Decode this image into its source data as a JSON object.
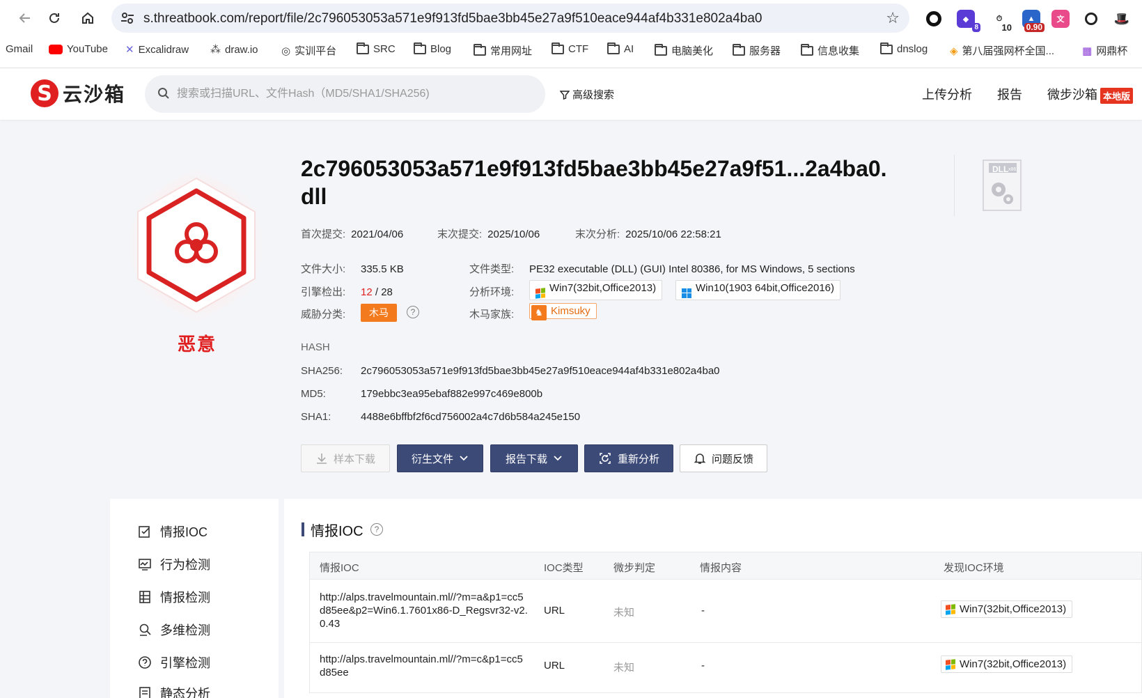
{
  "browser": {
    "url": "s.threatbook.com/report/file/2c796053053a571e9f913fd5bae3bb45e27a9f510eace944af4b331e802a4ba0",
    "extensions": [
      {
        "name": "circle-extension-icon",
        "badge": ""
      },
      {
        "name": "shield-extension-icon",
        "badge": "8"
      },
      {
        "name": "timer-extension-icon",
        "badge": "10"
      },
      {
        "name": "score-extension-icon",
        "badge": "0.90"
      },
      {
        "name": "translate-extension-icon",
        "badge": ""
      },
      {
        "name": "chatgpt-extension-icon",
        "badge": ""
      },
      {
        "name": "hat-extension-icon",
        "badge": ""
      }
    ],
    "bookmarks": [
      "Gmail",
      "YouTube",
      "Excalidraw",
      "draw.io",
      "实训平台",
      "SRC",
      "Blog",
      "常用网址",
      "CTF",
      "AI",
      "电脑美化",
      "服务器",
      "信息收集",
      "dnslog",
      "第八届强网杯全国...",
      "网鼎杯"
    ]
  },
  "header": {
    "logo_text": "云沙箱",
    "logo_letter": "S",
    "search_placeholder": "搜索或扫描URL、文件Hash（MD5/SHA1/SHA256)",
    "advanced_search": "高级搜索",
    "nav": [
      "上传分析",
      "报告",
      "微步沙箱"
    ],
    "local_badge": "本地版"
  },
  "summary": {
    "verdict": "恶意",
    "title": "2c796053053a571e9f913fd5bae3bb45e27a9f51...2a4ba0.dll",
    "file_type_badge": "DLL",
    "file_arch_badge": "x86",
    "first_submit_label": "首次提交:",
    "first_submit": "2021/04/06",
    "last_submit_label": "末次提交:",
    "last_submit": "2025/10/06",
    "last_analysis_label": "末次分析:",
    "last_analysis": "2025/10/06 22:58:21",
    "file_size_label": "文件大小:",
    "file_size": "335.5 KB",
    "file_type_label": "文件类型:",
    "file_type": "PE32 executable (DLL) (GUI) Intel 80386, for MS Windows, 5 sections",
    "engine_label": "引擎检出:",
    "engine_detected": "12",
    "engine_total": " / 28",
    "env_label": "分析环境:",
    "envs": [
      "Win7(32bit,Office2013)",
      "Win10(1903 64bit,Office2016)"
    ],
    "threat_label": "威胁分类:",
    "threat_class": "木马",
    "family_label": "木马家族:",
    "family": "Kimsuky",
    "help_glyph": "?"
  },
  "hash": {
    "label": "HASH",
    "sha256_label": "SHA256:",
    "sha256": "2c796053053a571e9f913fd5bae3bb45e27a9f510eace944af4b331e802a4ba0",
    "md5_label": "MD5:",
    "md5": "179ebbc3ea95ebaf882e997c469e800b",
    "sha1_label": "SHA1:",
    "sha1": "4488e6bffbf2f6cd756002a4c7d6b584a245e150"
  },
  "actions": {
    "download_sample": "样本下载",
    "derived_files": "衍生文件",
    "report_download": "报告下载",
    "reanalyze": "重新分析",
    "feedback": "问题反馈"
  },
  "sidebar": {
    "items": [
      "情报IOC",
      "行为检测",
      "情报检测",
      "多维检测",
      "引擎检测",
      "静态分析"
    ]
  },
  "ioc_section": {
    "title": "情报IOC",
    "columns": [
      "情报IOC",
      "IOC类型",
      "微步判定",
      "情报内容",
      "发现IOC环境"
    ],
    "rows": [
      {
        "ioc": "http://alps.travelmountain.ml//?m=a&p1=cc5d85ee&p2=Win6.1.7601x86-D_Regsvr32-v2.0.43",
        "type": "URL",
        "verdict": "未知",
        "content": "-",
        "env": "Win7(32bit,Office2013)"
      },
      {
        "ioc": "http://alps.travelmountain.ml//?m=c&p1=cc5d85ee",
        "type": "URL",
        "verdict": "未知",
        "content": "-",
        "env": "Win7(32bit,Office2013)"
      }
    ]
  },
  "colors": {
    "malicious_red": "#e02020",
    "brand_navy": "#3c4a78",
    "trojan_orange": "#f37b1d"
  }
}
